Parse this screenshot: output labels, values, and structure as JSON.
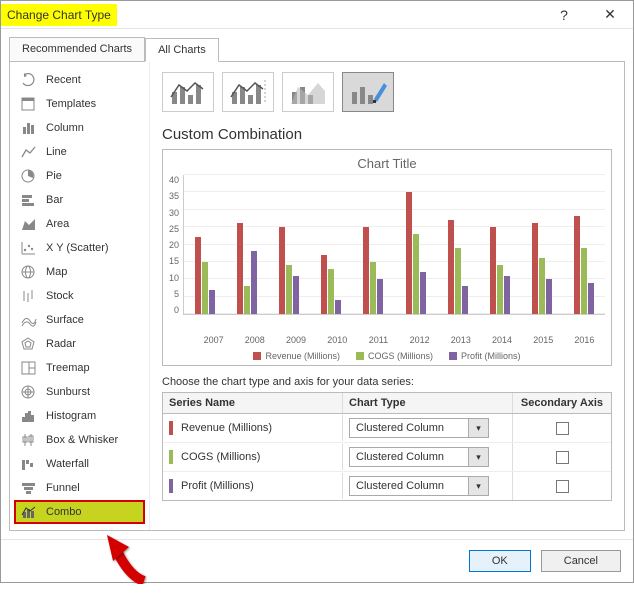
{
  "window": {
    "title": "Change Chart Type"
  },
  "tabs": {
    "recommended": "Recommended Charts",
    "all": "All Charts"
  },
  "sidebar": {
    "items": [
      {
        "label": "Recent"
      },
      {
        "label": "Templates"
      },
      {
        "label": "Column"
      },
      {
        "label": "Line"
      },
      {
        "label": "Pie"
      },
      {
        "label": "Bar"
      },
      {
        "label": "Area"
      },
      {
        "label": "X Y (Scatter)"
      },
      {
        "label": "Map"
      },
      {
        "label": "Stock"
      },
      {
        "label": "Surface"
      },
      {
        "label": "Radar"
      },
      {
        "label": "Treemap"
      },
      {
        "label": "Sunburst"
      },
      {
        "label": "Histogram"
      },
      {
        "label": "Box & Whisker"
      },
      {
        "label": "Waterfall"
      },
      {
        "label": "Funnel"
      },
      {
        "label": "Combo"
      }
    ]
  },
  "main": {
    "custom_title": "Custom Combination",
    "preview_title": "Chart Title",
    "instruction": "Choose the chart type and axis for your data series:",
    "headers": {
      "name": "Series Name",
      "type": "Chart Type",
      "axis": "Secondary Axis"
    },
    "series": [
      {
        "name": "Revenue (Millions)",
        "type": "Clustered Column"
      },
      {
        "name": "COGS (Millions)",
        "type": "Clustered Column"
      },
      {
        "name": "Profit (Millions)",
        "type": "Clustered Column"
      }
    ],
    "legend": {
      "r": "Revenue (Millions)",
      "g": "COGS (Millions)",
      "p": "Profit (Millions)"
    }
  },
  "footer": {
    "ok": "OK",
    "cancel": "Cancel"
  },
  "chart_data": {
    "type": "bar",
    "title": "Chart Title",
    "xlabel": "",
    "ylabel": "",
    "ylim": [
      0,
      40
    ],
    "ytick_step": 5,
    "categories": [
      "2007",
      "2008",
      "2009",
      "2010",
      "2011",
      "2012",
      "2013",
      "2014",
      "2015",
      "2016"
    ],
    "series": [
      {
        "name": "Revenue (Millions)",
        "color": "#c0504d",
        "values": [
          22,
          26,
          25,
          17,
          25,
          35,
          27,
          25,
          26,
          28
        ]
      },
      {
        "name": "COGS (Millions)",
        "color": "#9bbb59",
        "values": [
          15,
          8,
          14,
          13,
          15,
          23,
          19,
          14,
          16,
          19
        ]
      },
      {
        "name": "Profit (Millions)",
        "color": "#8064a2",
        "values": [
          7,
          18,
          11,
          4,
          10,
          12,
          8,
          11,
          10,
          9
        ]
      }
    ],
    "legend_position": "bottom"
  }
}
